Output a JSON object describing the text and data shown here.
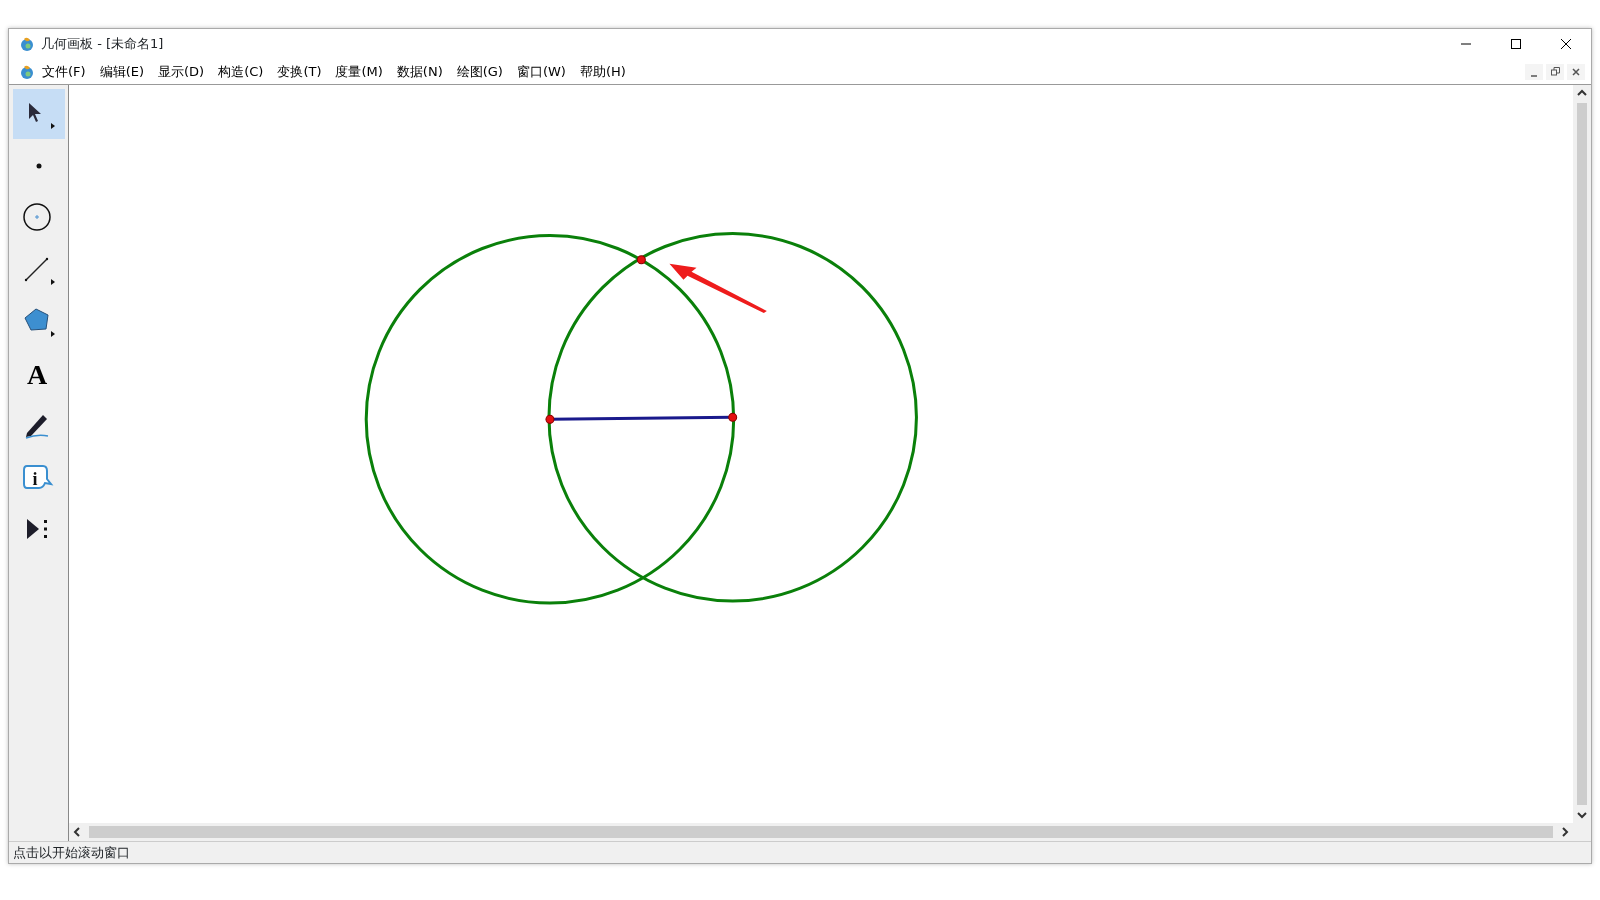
{
  "window": {
    "title": "几何画板 - [未命名1]"
  },
  "menu": [
    "文件(F)",
    "编辑(E)",
    "显示(D)",
    "构造(C)",
    "变换(T)",
    "度量(M)",
    "数据(N)",
    "绘图(G)",
    "窗口(W)",
    "帮助(H)"
  ],
  "tools": [
    {
      "kind": "select",
      "selected": true,
      "submenu": true
    },
    {
      "kind": "point",
      "selected": false,
      "submenu": false
    },
    {
      "kind": "compass",
      "selected": false,
      "submenu": false
    },
    {
      "kind": "line",
      "selected": false,
      "submenu": true
    },
    {
      "kind": "polygon",
      "selected": false,
      "submenu": true
    },
    {
      "kind": "text",
      "selected": false,
      "submenu": false,
      "glyph": "A"
    },
    {
      "kind": "marker",
      "selected": false,
      "submenu": false
    },
    {
      "kind": "info",
      "selected": false,
      "submenu": false,
      "glyph": "i"
    },
    {
      "kind": "custom",
      "selected": false,
      "submenu": false
    }
  ],
  "status_bar": "点击以开始滚动窗口"
}
